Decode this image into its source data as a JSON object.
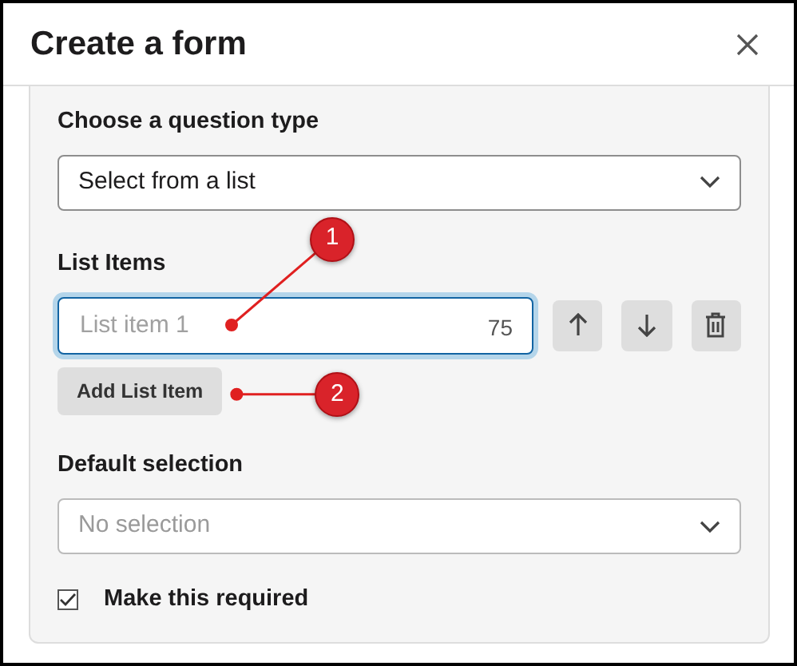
{
  "dialog": {
    "title": "Create a form"
  },
  "question_type": {
    "label": "Choose a question type",
    "value": "Select from a list"
  },
  "list_items": {
    "label": "List Items",
    "items": [
      {
        "placeholder": "List item 1",
        "counter": "75",
        "focused": true
      }
    ],
    "add_button": "Add List Item"
  },
  "default_selection": {
    "label": "Default selection",
    "placeholder": "No selection"
  },
  "required": {
    "label": "Make this required",
    "checked": true
  },
  "callouts": [
    {
      "number": "1",
      "kind": "inside"
    },
    {
      "number": "2",
      "kind": "beside"
    }
  ]
}
